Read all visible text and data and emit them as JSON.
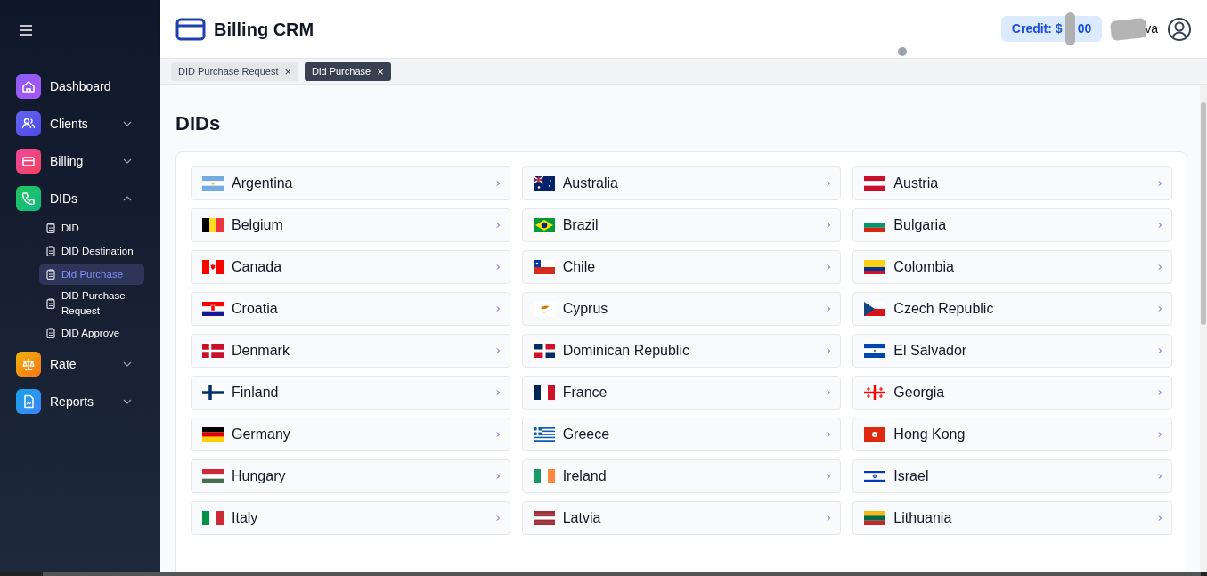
{
  "sidebar": {
    "items": [
      {
        "label": "Dashboard",
        "kind": "home"
      },
      {
        "label": "Clients",
        "kind": "users",
        "expanded": false
      },
      {
        "label": "Billing",
        "kind": "card",
        "expanded": false
      },
      {
        "label": "DIDs",
        "kind": "phone",
        "expanded": true,
        "children": [
          {
            "label": "DID",
            "selected": false
          },
          {
            "label": "DID Destination",
            "selected": false
          },
          {
            "label": "Did Purchase",
            "selected": true
          },
          {
            "label": "DID Purchase Request",
            "selected": false
          },
          {
            "label": "DID Approve",
            "selected": false
          }
        ]
      },
      {
        "label": "Rate",
        "kind": "scale",
        "expanded": false
      },
      {
        "label": "Reports",
        "kind": "report",
        "expanded": false
      }
    ]
  },
  "header": {
    "title": "Billing CRM",
    "credit_prefix": "Credit: $",
    "credit_suffix": "00",
    "user": "va"
  },
  "tabs": [
    {
      "label": "DID Purchase Request",
      "selected": false,
      "close": "×"
    },
    {
      "label": "Did Purchase",
      "selected": true,
      "close": "×"
    }
  ],
  "page": {
    "title": "DIDs"
  },
  "countries": [
    {
      "name": "Argentina"
    },
    {
      "name": "Australia"
    },
    {
      "name": "Austria"
    },
    {
      "name": "Belgium"
    },
    {
      "name": "Brazil"
    },
    {
      "name": "Bulgaria"
    },
    {
      "name": "Canada"
    },
    {
      "name": "Chile"
    },
    {
      "name": "Colombia"
    },
    {
      "name": "Croatia"
    },
    {
      "name": "Cyprus"
    },
    {
      "name": "Czech Republic"
    },
    {
      "name": "Denmark"
    },
    {
      "name": "Dominican Republic"
    },
    {
      "name": "El Salvador"
    },
    {
      "name": "Finland"
    },
    {
      "name": "France"
    },
    {
      "name": "Georgia"
    },
    {
      "name": "Germany"
    },
    {
      "name": "Greece"
    },
    {
      "name": "Hong Kong"
    },
    {
      "name": "Hungary"
    },
    {
      "name": "Ireland"
    },
    {
      "name": "Israel"
    },
    {
      "name": "Italy"
    },
    {
      "name": "Latvia"
    },
    {
      "name": "Lithuania"
    }
  ]
}
